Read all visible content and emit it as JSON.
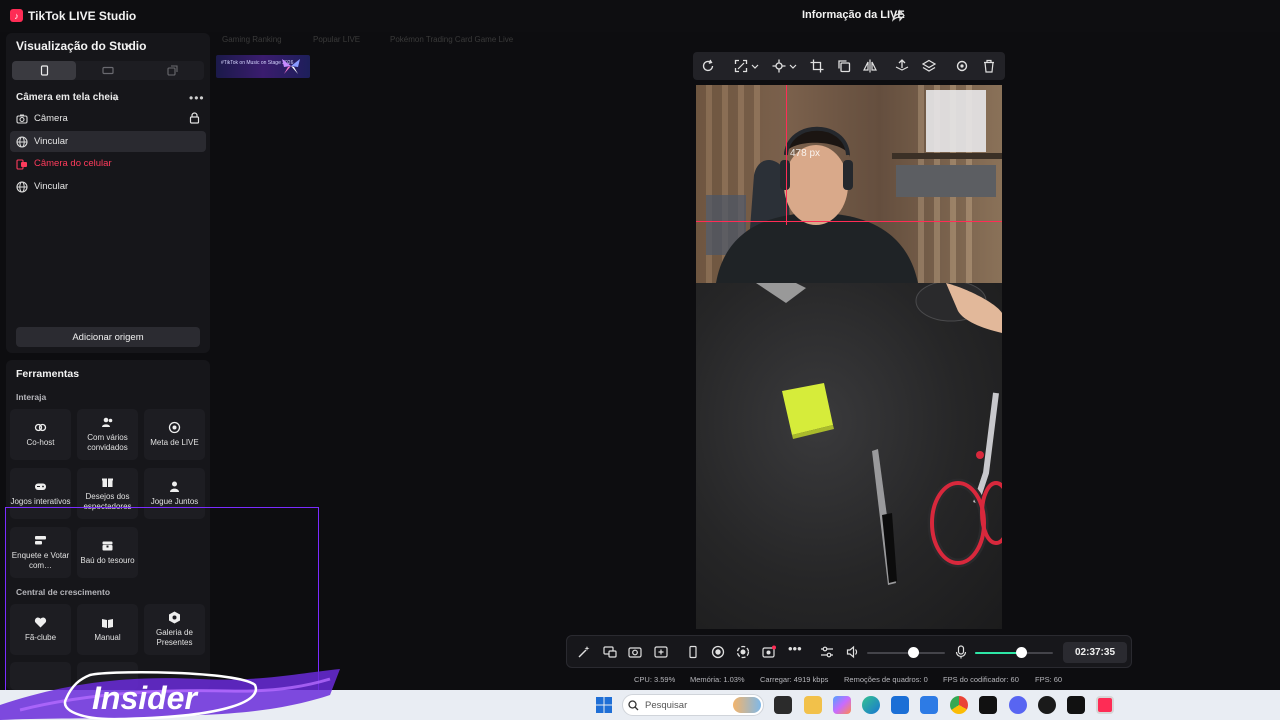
{
  "app": {
    "title": "TikTok LIVE Studio",
    "logo_icon": "tiktok-logo-icon"
  },
  "header": {
    "live_info": "Informação da LIVE"
  },
  "studio": {
    "title": "Visualização do Studio",
    "scene": "Câmera em tela cheia",
    "sources": [
      {
        "label": "Câmera",
        "icon": "camera-icon",
        "locked": true
      },
      {
        "label": "Vincular",
        "icon": "globe-icon",
        "selected": true
      },
      {
        "label": "Câmera do celular",
        "icon": "phone-camera-icon",
        "error": true
      },
      {
        "label": "Vincular",
        "icon": "globe-icon"
      }
    ],
    "add_source": "Adicionar origem"
  },
  "tools": {
    "title": "Ferramentas",
    "sections": [
      {
        "label": "Interaja"
      },
      {
        "label": "Central de crescimento"
      }
    ],
    "interact": [
      {
        "label": "Co-host",
        "icon": "link-icon"
      },
      {
        "label": "Com vários convidados",
        "icon": "users-icon"
      },
      {
        "label": "Meta de LIVE",
        "icon": "target-icon"
      },
      {
        "label": "Jogos interativos",
        "icon": "gamepad-icon"
      },
      {
        "label": "Desejos dos espectadores",
        "icon": "gift-icon"
      },
      {
        "label": "Jogue Juntos",
        "icon": "person-icon"
      },
      {
        "label": "Enquete e Votar com…",
        "icon": "poll-icon"
      },
      {
        "label": "Baú do tesouro",
        "icon": "chest-icon"
      }
    ],
    "growth": [
      {
        "label": "Fã-clube",
        "icon": "heart-icon"
      },
      {
        "label": "Manual",
        "icon": "book-icon"
      },
      {
        "label": "Galeria de Presentes",
        "icon": "gift-gallery-icon"
      }
    ]
  },
  "categories": [
    "Gaming Ranking",
    "Popular LIVE",
    "Pokémon Trading Card Game Live"
  ],
  "thumb_text": "#TikTok on Music on Stage 2026",
  "preview": {
    "guide_label": "478 px"
  },
  "controls": {
    "timer": "02:37:35",
    "volume_level": 0.6,
    "mic_level": 0.6
  },
  "stats": {
    "cpu": "CPU:  3.59%",
    "memory": "Memória:  1.03%",
    "upload": "Carregar:  4919 kbps",
    "dropped": "Remoções de quadros:  0",
    "encoder_fps": "FPS do codificador:  60",
    "fps": "FPS:  60"
  },
  "taskbar": {
    "search_placeholder": "Pesquisar"
  },
  "overlay": {
    "logo_text": "Insider"
  },
  "colors": {
    "accent": "#fe2c55",
    "mic_green": "#2ee6a6",
    "overlay_purple": "#7a2cff"
  }
}
